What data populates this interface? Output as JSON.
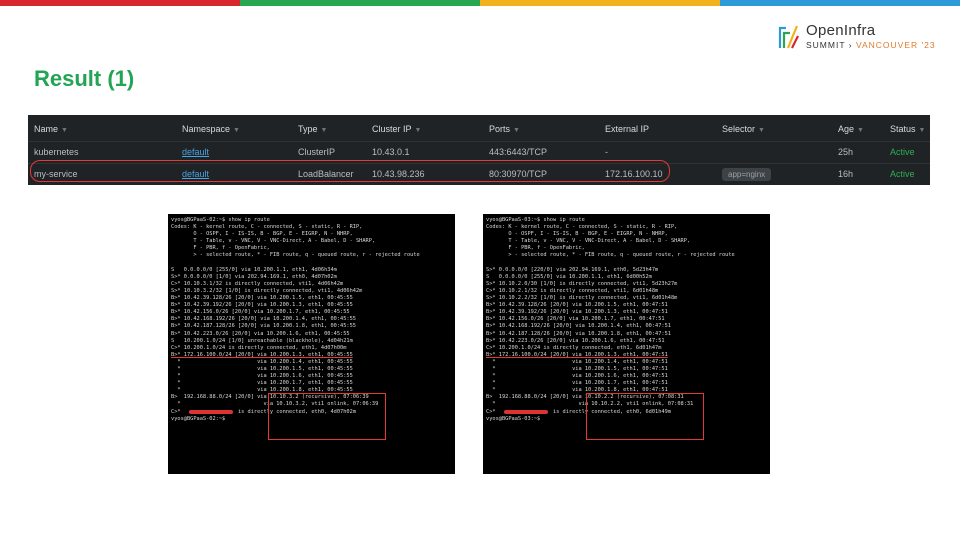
{
  "accent_colors": {
    "bar1": "#d6262e",
    "bar2": "#2aa652",
    "bar3": "#f2b21b",
    "bar4": "#2d9bd7",
    "title": "#23a455"
  },
  "logo": {
    "line1": "OpenInfra",
    "line2_a": "SUMMIT",
    "line2_b": "VANCOUVER '23"
  },
  "title": "Result (1)",
  "services_table": {
    "headers": [
      "Name",
      "Namespace",
      "Type",
      "Cluster IP",
      "Ports",
      "External IP",
      "Selector",
      "Age",
      "Status"
    ],
    "rows": [
      {
        "name": "kubernetes",
        "namespace": "default",
        "type": "ClusterIP",
        "cluster_ip": "10.43.0.1",
        "ports": "443:6443/TCP",
        "external_ip": "-",
        "selector": "",
        "age": "25h",
        "status": "Active"
      },
      {
        "name": "my-service",
        "namespace": "default",
        "type": "LoadBalancer",
        "cluster_ip": "10.43.98.236",
        "ports": "80:30970/TCP",
        "external_ip": "172.16.100.10",
        "selector": "app=nginx",
        "age": "16h",
        "status": "Active"
      }
    ]
  },
  "terminal_left": {
    "lines": [
      "vyos@BGPaaS-02:~$ show ip route",
      "Codes: K - kernel route, C - connected, S - static, R - RIP,",
      "       O - OSPF, I - IS-IS, B - BGP, E - EIGRP, N - NHRP,",
      "       T - Table, v - VNC, V - VNC-Direct, A - Babel, D - SHARP,",
      "       F - PBR, f - OpenFabric,",
      "       > - selected route, * - FIB route, q - queued route, r - rejected route",
      "",
      "S   0.0.0.0/0 [255/0] via 10.200.1.1, eth1, 4d06h34m",
      "S>* 0.0.0.0/0 [1/0] via 202.94.169.1, eth0, 4d07h02m",
      "C>* 10.10.3.1/32 is directly connected, vti1, 4d06h42m",
      "S>* 10.10.3.2/32 [1/0] is directly connected, vti1, 4d06h42m",
      "B>* 10.42.39.128/26 [20/0] via 10.200.1.5, eth1, 00:45:55",
      "B>* 10.42.39.192/26 [20/0] via 10.200.1.3, eth1, 00:45:55",
      "B>* 10.42.156.0/26 [20/0] via 10.200.1.7, eth1, 00:45:55",
      "B>* 10.42.168.192/26 [20/0] via 10.200.1.4, eth1, 00:45:55",
      "B>* 10.42.187.128/26 [20/0] via 10.200.1.8, eth1, 00:45:55",
      "B>* 10.42.223.0/26 [20/0] via 10.200.1.6, eth1, 00:45:55",
      "S   10.200.1.0/24 [1/0] unreachable (blackhole), 4d04h21m",
      "C>* 10.200.1.0/24 is directly connected, eth1, 4d07h00m",
      "B>* 172.16.100.0/24 [20/0] via 10.200.1.3, eth1, 00:45:55",
      "  *                        via 10.200.1.4, eth1, 00:45:55",
      "  *                        via 10.200.1.5, eth1, 00:45:55",
      "  *                        via 10.200.1.6, eth1, 00:45:55",
      "  *                        via 10.200.1.7, eth1, 00:45:55",
      "  *                        via 10.200.1.8, eth1, 00:45:55",
      "B>  192.168.88.0/24 [20/0] via 10.10.3.2 (recursive), 07:06:39",
      "  *                          via 10.10.3.2, vti1 onlink, 07:06:39",
      "C>*                  is directly connected, eth0, 4d07h02m",
      "vyos@BGPaaS-02:~$"
    ]
  },
  "terminal_right": {
    "lines": [
      "vyos@BGPaaS-03:~$ show ip route",
      "Codes: K - kernel route, C - connected, S - static, R - RIP,",
      "       O - OSPF, I - IS-IS, B - BGP, E - EIGRP, N - NHRP,",
      "       T - Table, v - VNC, V - VNC-Direct, A - Babel, D - SHARP,",
      "       F - PBR, f - OpenFabric,",
      "       > - selected route, * - FIB route, q - queued route, r - rejected route",
      "",
      "S>* 0.0.0.0/0 [220/0] via 202.94.169.1, eth0, 5d23h47m",
      "S   0.0.0.0/0 [255/0] via 10.200.1.1, eth1, 6d00h52m",
      "S>* 10.10.2.0/30 [1/0] is directly connected, vti1, 5d23h27m",
      "C>* 10.10.2.1/32 is directly connected, vti1, 6d01h48m",
      "S>* 10.10.2.2/32 [1/0] is directly connected, vti1, 6d01h48m",
      "B>* 10.42.39.128/26 [20/0] via 10.200.1.5, eth1, 00:47:51",
      "B>* 10.42.39.192/26 [20/0] via 10.200.1.3, eth1, 00:47:51",
      "B>* 10.42.156.0/26 [20/0] via 10.200.1.7, eth1, 00:47:51",
      "B>* 10.42.168.192/26 [20/0] via 10.200.1.4, eth1, 00:47:51",
      "B>* 10.42.187.128/26 [20/0] via 10.200.1.8, eth1, 00:47:51",
      "B>* 10.42.223.0/26 [20/0] via 10.200.1.6, eth1, 00:47:51",
      "C>* 10.200.1.0/24 is directly connected, eth1, 6d01h47m",
      "B>* 172.16.100.0/24 [20/0] via 10.200.1.3, eth1, 00:47:51",
      "  *                        via 10.200.1.4, eth1, 00:47:51",
      "  *                        via 10.200.1.5, eth1, 00:47:51",
      "  *                        via 10.200.1.6, eth1, 00:47:51",
      "  *                        via 10.200.1.7, eth1, 00:47:51",
      "  *                        via 10.200.1.8, eth1, 00:47:51",
      "B>  192.168.88.0/24 [20/0] via 10.10.2.2 (recursive), 07:08:31",
      "  *                          via 10.10.2.2, vti1 onlink, 07:08:31",
      "C>*                  is directly connected, eth0, 6d01h49m",
      "vyos@BGPaaS-03:~$"
    ]
  }
}
